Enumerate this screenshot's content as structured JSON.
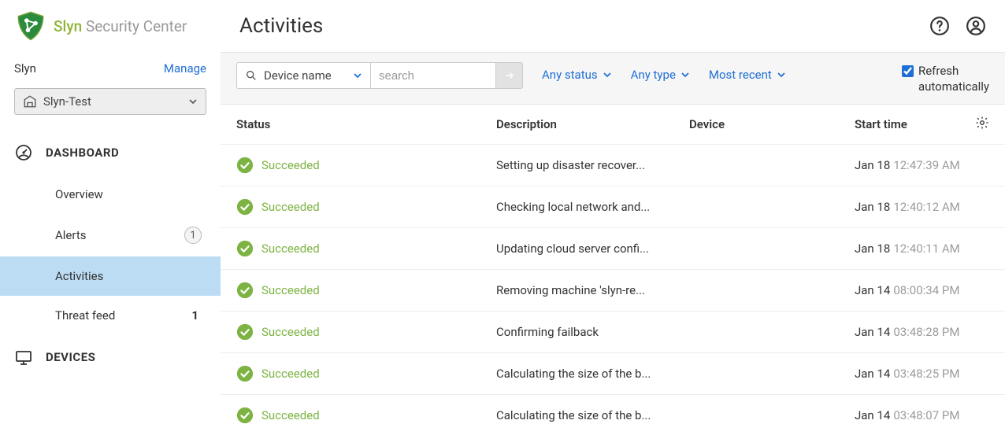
{
  "brand": {
    "name": "Slyn",
    "suffix": "Security Center"
  },
  "org": {
    "name": "Slyn",
    "manage": "Manage"
  },
  "device_selector": {
    "selected": "Slyn-Test"
  },
  "nav": {
    "sections": [
      {
        "label": "DASHBOARD",
        "icon": "dashboard-icon",
        "items": [
          {
            "label": "Overview",
            "active": false
          },
          {
            "label": "Alerts",
            "active": false,
            "badge": "1"
          },
          {
            "label": "Activities",
            "active": true
          },
          {
            "label": "Threat feed",
            "active": false,
            "count": "1"
          }
        ]
      },
      {
        "label": "DEVICES",
        "icon": "devices-icon",
        "items": []
      }
    ]
  },
  "page": {
    "title": "Activities"
  },
  "toolbar": {
    "device_field_label": "Device name",
    "search_placeholder": "search",
    "filters": {
      "status": "Any status",
      "type": "Any type",
      "sort": "Most recent"
    },
    "refresh_label": "Refresh\nautomatically",
    "refresh_checked": true
  },
  "columns": {
    "status": "Status",
    "description": "Description",
    "device": "Device",
    "start_time": "Start time"
  },
  "rows": [
    {
      "status": "Succeeded",
      "description": "Setting up disaster recover...",
      "device": "",
      "date": "Jan 18",
      "time": "12:47:39 AM"
    },
    {
      "status": "Succeeded",
      "description": "Checking local network and...",
      "device": "",
      "date": "Jan 18",
      "time": "12:40:12 AM"
    },
    {
      "status": "Succeeded",
      "description": "Updating cloud server confi...",
      "device": "",
      "date": "Jan 18",
      "time": "12:40:11 AM"
    },
    {
      "status": "Succeeded",
      "description": "Removing machine 'slyn-re...",
      "device": "",
      "date": "Jan 14",
      "time": "08:00:34 PM"
    },
    {
      "status": "Succeeded",
      "description": "Confirming failback",
      "device": "",
      "date": "Jan 14",
      "time": "03:48:28 PM"
    },
    {
      "status": "Succeeded",
      "description": "Calculating the size of the b...",
      "device": "",
      "date": "Jan 14",
      "time": "03:48:25 PM"
    },
    {
      "status": "Succeeded",
      "description": "Calculating the size of the b...",
      "device": "",
      "date": "Jan 14",
      "time": "03:48:07 PM"
    }
  ],
  "colors": {
    "link": "#1f6fd4",
    "success": "#7cb342",
    "active_bg": "#bcdcf4"
  }
}
